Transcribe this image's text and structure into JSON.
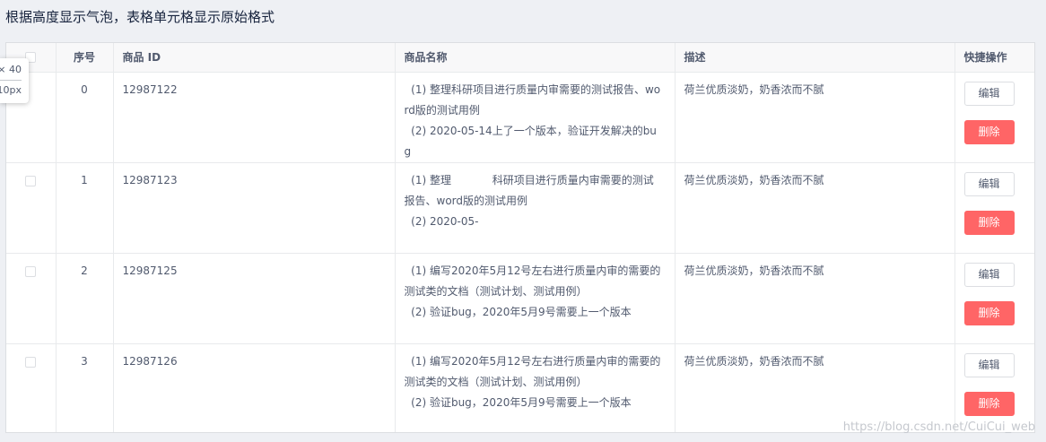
{
  "page": {
    "title": "根据高度显示气泡，表格单元格显示原始格式"
  },
  "tooltip": {
    "line1": "× 40",
    "line2": "10px"
  },
  "table": {
    "columns": [
      "",
      "序号",
      "商品 ID",
      "商品名称",
      "描述",
      "快捷操作"
    ],
    "rows": [
      {
        "index": "0",
        "id": "12987122",
        "name": "  (1) 整理科研项目进行质量内审需要的测试报告、word版的测试用例\n  (2) 2020-05-14上了一个版本，验证开发解决的bug",
        "desc": "荷兰优质淡奶，奶香浓而不腻"
      },
      {
        "index": "1",
        "id": "12987123",
        "name": "  (1) 整理            科研项目进行质量内审需要的测试报告、word版的测试用例\n  (2) 2020-05-",
        "desc": "荷兰优质淡奶，奶香浓而不腻"
      },
      {
        "index": "2",
        "id": "12987125",
        "name": "  (1) 编写2020年5月12号左右进行质量内审的需要的测试类的文档（测试计划、测试用例）\n  (2) 验证bug，2020年5月9号需要上一个版本",
        "desc": "荷兰优质淡奶，奶香浓而不腻"
      },
      {
        "index": "3",
        "id": "12987126",
        "name": "  (1) 编写2020年5月12号左右进行质量内审的需要的测试类的文档（测试计划、测试用例）\n  (2) 验证bug，2020年5月9号需要上一个版本",
        "desc": "荷兰优质淡奶，奶香浓而不腻"
      }
    ],
    "actions": {
      "edit_label": "编辑",
      "delete_label": "删除"
    }
  },
  "watermark": "https://blog.csdn.net/CuiCui_web",
  "colors": {
    "delete_button": "#ff6566",
    "header_bg": "#f8f8f9",
    "page_bg": "#eef0f4"
  }
}
